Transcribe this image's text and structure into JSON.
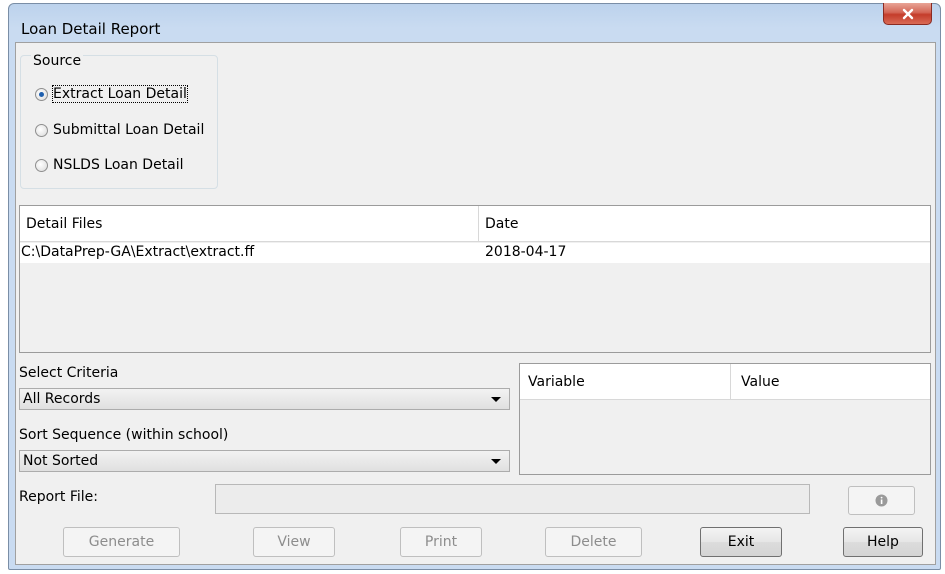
{
  "window": {
    "title": "Loan Detail Report",
    "close_label": "X"
  },
  "source": {
    "legend": "Source",
    "options": [
      {
        "label": "Extract Loan Detail",
        "checked": true
      },
      {
        "label": "Submittal Loan Detail",
        "checked": false
      },
      {
        "label": "NSLDS Loan Detail",
        "checked": false
      }
    ]
  },
  "detail_files": {
    "columns": [
      "Detail Files",
      "Date"
    ],
    "rows": [
      {
        "file": "C:\\DataPrep-GA\\Extract\\extract.ff",
        "date": "2018-04-17"
      }
    ]
  },
  "select_criteria": {
    "label": "Select Criteria",
    "value": "All Records"
  },
  "sort_sequence": {
    "label": "Sort Sequence (within school)",
    "value": "Not Sorted"
  },
  "variables": {
    "columns": [
      "Variable",
      "Value"
    ]
  },
  "report_file": {
    "label": "Report File:",
    "value": ""
  },
  "buttons": {
    "generate": "Generate",
    "view": "View",
    "print": "Print",
    "delete": "Delete",
    "exit": "Exit",
    "help": "Help"
  },
  "icons": {
    "close": "close-icon",
    "info": "info-icon",
    "dropdown": "chevron-down-icon"
  }
}
